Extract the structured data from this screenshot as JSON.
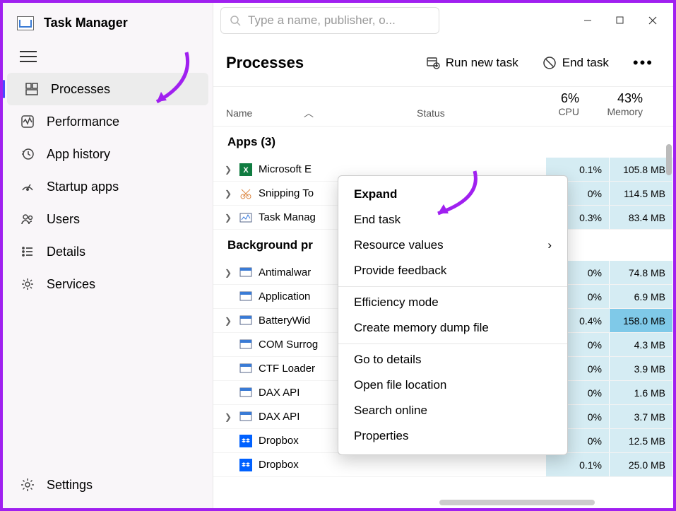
{
  "app": {
    "title": "Task Manager"
  },
  "search": {
    "placeholder": "Type a name, publisher, o..."
  },
  "sidebar": {
    "items": [
      {
        "label": "Processes",
        "active": true
      },
      {
        "label": "Performance"
      },
      {
        "label": "App history"
      },
      {
        "label": "Startup apps"
      },
      {
        "label": "Users"
      },
      {
        "label": "Details"
      },
      {
        "label": "Services"
      }
    ],
    "settings": "Settings"
  },
  "header": {
    "title": "Processes",
    "run_new": "Run new task",
    "end_task": "End task"
  },
  "columns": {
    "name": "Name",
    "status": "Status",
    "cpu_pct": "6%",
    "cpu_lbl": "CPU",
    "mem_pct": "43%",
    "mem_lbl": "Memory"
  },
  "groups": {
    "apps": "Apps (3)",
    "bg": "Background pr"
  },
  "rows": [
    {
      "grp": "apps",
      "exp": true,
      "name": "Microsoft E",
      "cpu": "0.1%",
      "mem": "105.8 MB",
      "icon": "excel"
    },
    {
      "grp": "apps",
      "exp": true,
      "name": "Snipping To",
      "cpu": "0%",
      "mem": "114.5 MB",
      "icon": "snip"
    },
    {
      "grp": "apps",
      "exp": true,
      "name": "Task Manag",
      "cpu": "0.3%",
      "mem": "83.4 MB",
      "icon": "tm"
    },
    {
      "grp": "bg",
      "exp": true,
      "name": "Antimalwar",
      "cpu": "0%",
      "mem": "74.8 MB",
      "icon": "gen"
    },
    {
      "grp": "bg",
      "exp": false,
      "name": "Application",
      "cpu": "0%",
      "mem": "6.9 MB",
      "icon": "gen"
    },
    {
      "grp": "bg",
      "exp": true,
      "name": "BatteryWid",
      "cpu": "0.4%",
      "mem": "158.0 MB",
      "icon": "gen",
      "hot": true
    },
    {
      "grp": "bg",
      "exp": false,
      "name": "COM Surrog",
      "cpu": "0%",
      "mem": "4.3 MB",
      "icon": "gen"
    },
    {
      "grp": "bg",
      "exp": false,
      "name": "CTF Loader",
      "cpu": "0%",
      "mem": "3.9 MB",
      "icon": "gen"
    },
    {
      "grp": "bg",
      "exp": false,
      "name": "DAX API",
      "cpu": "0%",
      "mem": "1.6 MB",
      "icon": "gen"
    },
    {
      "grp": "bg",
      "exp": true,
      "name": "DAX API",
      "cpu": "0%",
      "mem": "3.7 MB",
      "icon": "gen"
    },
    {
      "grp": "bg",
      "exp": false,
      "name": "Dropbox",
      "cpu": "0%",
      "mem": "12.5 MB",
      "icon": "db"
    },
    {
      "grp": "bg",
      "exp": false,
      "name": "Dropbox",
      "cpu": "0.1%",
      "mem": "25.0 MB",
      "icon": "db"
    }
  ],
  "context_menu": [
    {
      "label": "Expand",
      "bold": true
    },
    {
      "label": "End task"
    },
    {
      "label": "Resource values",
      "sub": true
    },
    {
      "label": "Provide feedback"
    },
    {
      "sep": true
    },
    {
      "label": "Efficiency mode"
    },
    {
      "label": "Create memory dump file"
    },
    {
      "sep": true
    },
    {
      "label": "Go to details"
    },
    {
      "label": "Open file location"
    },
    {
      "label": "Search online"
    },
    {
      "label": "Properties"
    }
  ]
}
